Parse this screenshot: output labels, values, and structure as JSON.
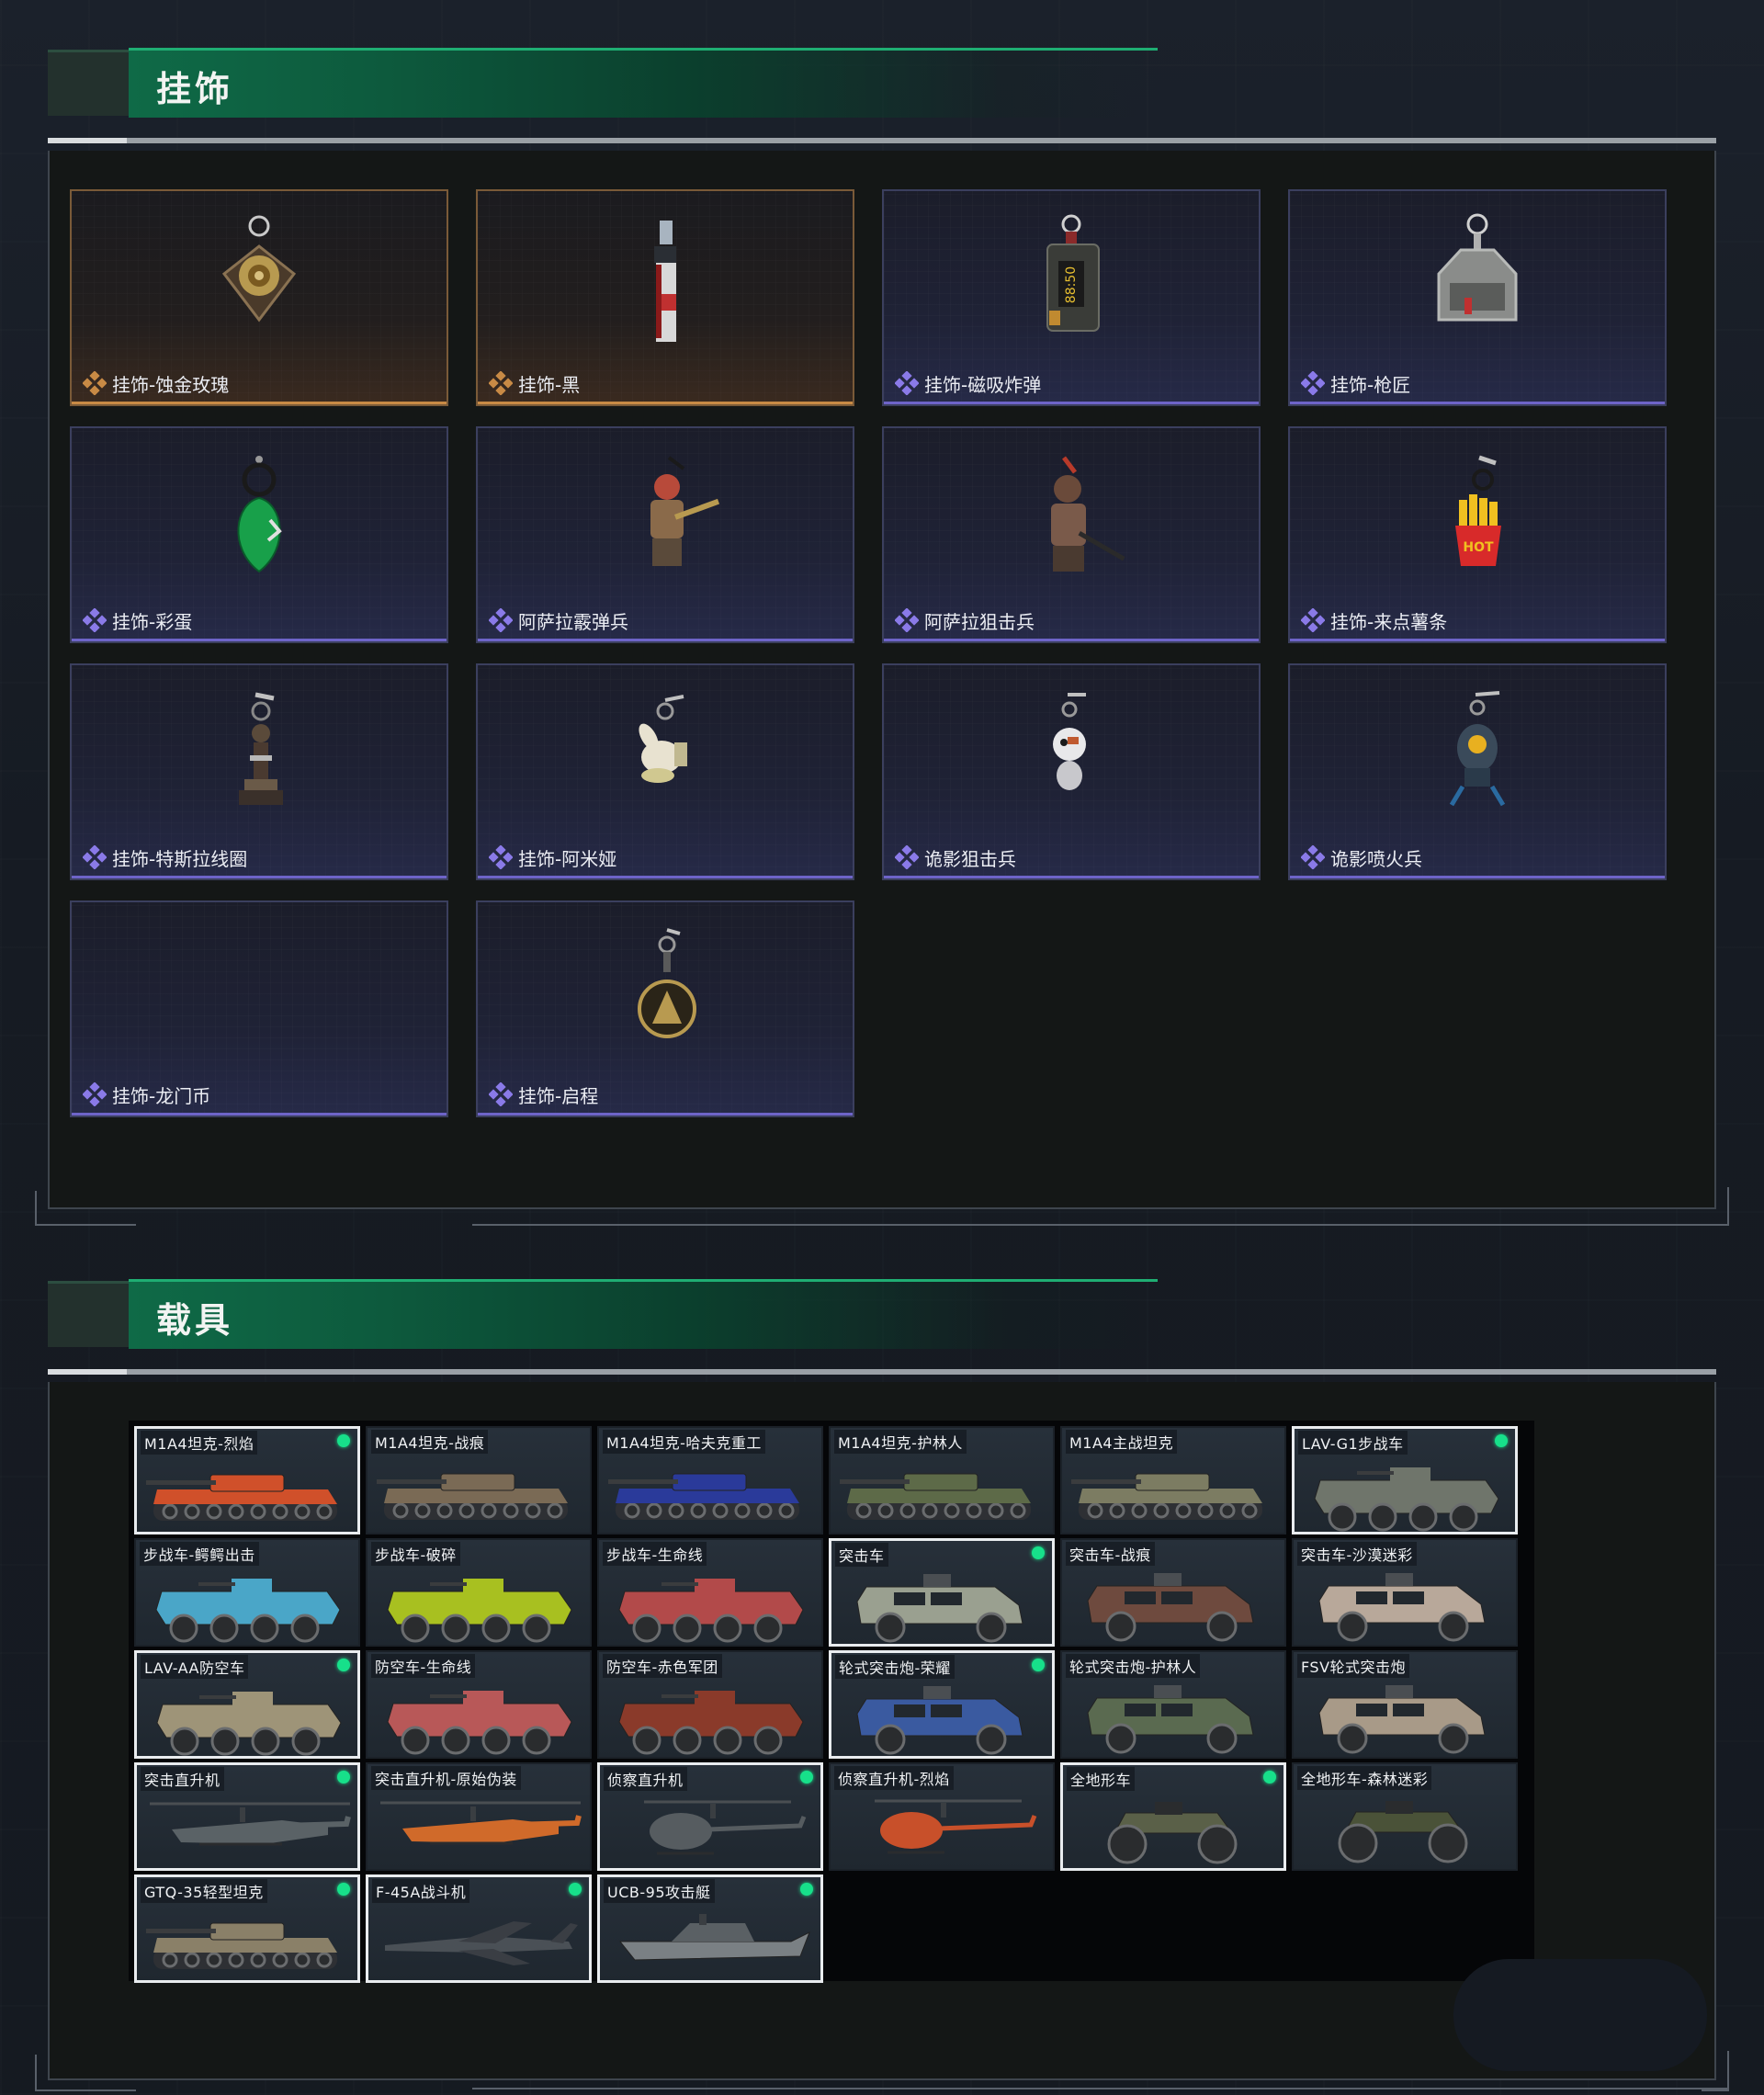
{
  "sections": {
    "charms": {
      "title": "挂饰"
    },
    "vehicles": {
      "title": "载具"
    }
  },
  "charm_items": [
    {
      "label": "挂饰-蚀金玫瑰",
      "rarity": "gold",
      "icon": "rose-charm-icon"
    },
    {
      "label": "挂饰-黑",
      "rarity": "gold",
      "icon": "knife-charm-icon"
    },
    {
      "label": "挂饰-磁吸炸弹",
      "rarity": "purple",
      "icon": "bomb-charm-icon"
    },
    {
      "label": "挂饰-枪匠",
      "rarity": "purple",
      "icon": "toolbox-charm-icon"
    },
    {
      "label": "挂饰-彩蛋",
      "rarity": "purple",
      "icon": "egg-charm-icon"
    },
    {
      "label": "阿萨拉霰弹兵",
      "rarity": "purple",
      "icon": "soldier-charm-icon"
    },
    {
      "label": "阿萨拉狙击兵",
      "rarity": "purple",
      "icon": "sniper-charm-icon"
    },
    {
      "label": "挂饰-来点薯条",
      "rarity": "purple",
      "icon": "fries-charm-icon"
    },
    {
      "label": "挂饰-特斯拉线圈",
      "rarity": "purple",
      "icon": "coil-charm-icon"
    },
    {
      "label": "挂饰-阿米娅",
      "rarity": "purple",
      "icon": "bunny-charm-icon"
    },
    {
      "label": "诡影狙击兵",
      "rarity": "purple",
      "icon": "ghost-sniper-charm-icon"
    },
    {
      "label": "诡影喷火兵",
      "rarity": "purple",
      "icon": "ghost-flamer-charm-icon"
    },
    {
      "label": "挂饰-龙门币",
      "rarity": "purple",
      "icon": ""
    },
    {
      "label": "挂饰-启程",
      "rarity": "purple",
      "icon": "medal-charm-icon"
    }
  ],
  "vehicle_items": [
    {
      "name": "M1A4坦克-烈焰",
      "type": "tank",
      "owned": true,
      "selected": true,
      "color": "#d0502a"
    },
    {
      "name": "M1A4坦克-战痕",
      "type": "tank",
      "owned": false,
      "selected": false,
      "color": "#7a6a55"
    },
    {
      "name": "M1A4坦克-哈夫克重工",
      "type": "tank",
      "owned": false,
      "selected": false,
      "color": "#2a3a9a"
    },
    {
      "name": "M1A4坦克-护林人",
      "type": "tank",
      "owned": false,
      "selected": false,
      "color": "#5d6a48"
    },
    {
      "name": "M1A4主战坦克",
      "type": "tank",
      "owned": false,
      "selected": false,
      "color": "#7c7c62"
    },
    {
      "name": "LAV-G1步战车",
      "type": "ifv",
      "owned": true,
      "selected": true,
      "color": "#6f756b"
    },
    {
      "name": "步战车-鳄鳄出击",
      "type": "ifv",
      "owned": false,
      "selected": false,
      "color": "#4aa6c8"
    },
    {
      "name": "步战车-破碎",
      "type": "ifv",
      "owned": false,
      "selected": false,
      "color": "#a8c020"
    },
    {
      "name": "步战车-生命线",
      "type": "ifv",
      "owned": false,
      "selected": false,
      "color": "#b24a4a"
    },
    {
      "name": "突击车",
      "type": "mrap",
      "owned": true,
      "selected": true,
      "color": "#9aa090"
    },
    {
      "name": "突击车-战痕",
      "type": "mrap",
      "owned": false,
      "selected": false,
      "color": "#6e4a3e"
    },
    {
      "name": "突击车-沙漠迷彩",
      "type": "mrap",
      "owned": false,
      "selected": false,
      "color": "#b8a89a"
    },
    {
      "name": "LAV-AA防空车",
      "type": "ifv",
      "owned": true,
      "selected": true,
      "color": "#9e9478"
    },
    {
      "name": "防空车-生命线",
      "type": "ifv",
      "owned": false,
      "selected": false,
      "color": "#b85858"
    },
    {
      "name": "防空车-赤色军团",
      "type": "ifv",
      "owned": false,
      "selected": false,
      "color": "#8a3a2a"
    },
    {
      "name": "轮式突击炮-荣耀",
      "type": "mrap",
      "owned": true,
      "selected": true,
      "color": "#3a5aa0"
    },
    {
      "name": "轮式突击炮-护林人",
      "type": "mrap",
      "owned": false,
      "selected": false,
      "color": "#5a6a50"
    },
    {
      "name": "FSV轮式突击炮",
      "type": "mrap",
      "owned": false,
      "selected": false,
      "color": "#a89a88"
    },
    {
      "name": "突击直升机",
      "type": "heli",
      "owned": true,
      "selected": true,
      "color": "#5a6266"
    },
    {
      "name": "突击直升机-原始伪装",
      "type": "heli",
      "owned": false,
      "selected": false,
      "color": "#d06a2a"
    },
    {
      "name": "侦察直升机",
      "type": "scout",
      "owned": true,
      "selected": true,
      "color": "#565c60"
    },
    {
      "name": "侦察直升机-烈焰",
      "type": "scout",
      "owned": false,
      "selected": false,
      "color": "#c8502a"
    },
    {
      "name": "全地形车",
      "type": "atv",
      "owned": true,
      "selected": true,
      "color": "#5a6048"
    },
    {
      "name": "全地形车-森林迷彩",
      "type": "atv",
      "owned": false,
      "selected": false,
      "color": "#4a5238"
    },
    {
      "name": "GTQ-35轻型坦克",
      "type": "tank",
      "owned": true,
      "selected": true,
      "color": "#8a8068"
    },
    {
      "name": "F-45A战斗机",
      "type": "jet",
      "owned": true,
      "selected": true,
      "color": "#4a5056"
    },
    {
      "name": "UCB-95攻击艇",
      "type": "boat",
      "owned": true,
      "selected": true,
      "color": "#7a8084"
    }
  ],
  "colors": {
    "accent_green": "#17e08a",
    "gold_rarity": "#c88a45",
    "purple_rarity": "#8a7ae8"
  }
}
